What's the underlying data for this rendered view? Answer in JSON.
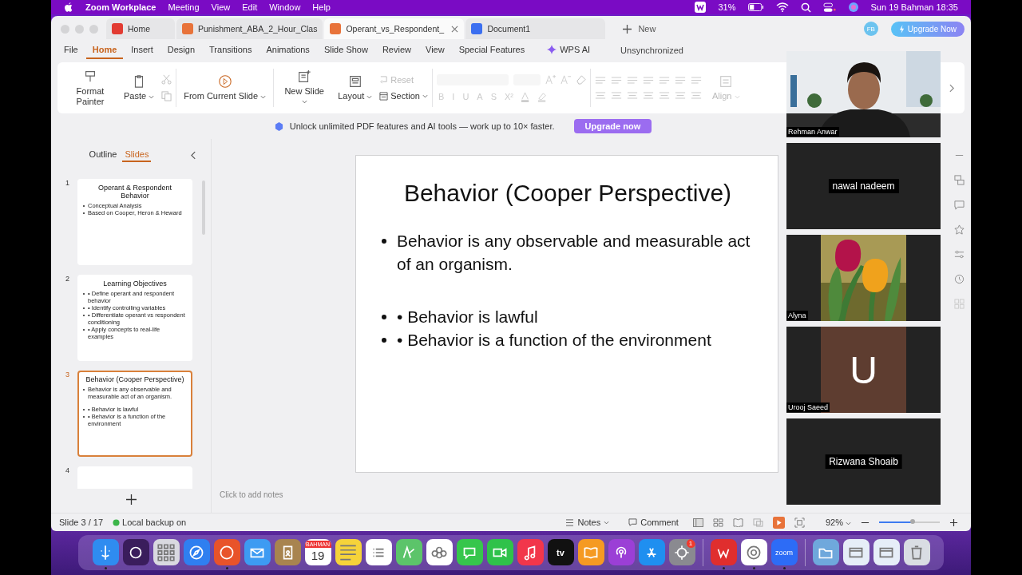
{
  "menubar": {
    "app": "Zoom Workplace",
    "items": [
      "Meeting",
      "View",
      "Edit",
      "Window",
      "Help"
    ],
    "battery": "31%",
    "clock": "Sun 19 Bahman  18:35"
  },
  "tabs": [
    {
      "label": "Home",
      "kind": "wps",
      "selected": false
    },
    {
      "label": "Punishment_ABA_2_Hour_Clas",
      "kind": "slides",
      "selected": false
    },
    {
      "label": "Operant_vs_Respondent_",
      "kind": "slides",
      "selected": true
    },
    {
      "label": "Document1",
      "kind": "doc",
      "selected": false
    }
  ],
  "new_tab": "New",
  "account": "FB",
  "upgrade_button": "Upgrade Now",
  "menu": [
    {
      "label": "File",
      "selected": false
    },
    {
      "label": "Home",
      "selected": true
    },
    {
      "label": "Insert",
      "selected": false
    },
    {
      "label": "Design",
      "selected": false
    },
    {
      "label": "Transitions",
      "selected": false
    },
    {
      "label": "Animations",
      "selected": false
    },
    {
      "label": "Slide Show",
      "selected": false
    },
    {
      "label": "Review",
      "selected": false
    },
    {
      "label": "View",
      "selected": false
    },
    {
      "label": "Special Features",
      "selected": false
    }
  ],
  "wps_ai": "WPS AI",
  "sync_status": "Unsynchronized",
  "ribbon": {
    "format_painter": "Format Painter",
    "paste": "Paste",
    "from_current_slide": "From Current Slide",
    "new_slide": "New Slide",
    "layout": "Layout",
    "reset": "Reset",
    "section": "Section",
    "format_glyphs": [
      "B",
      "I",
      "U",
      "A",
      "S",
      "X²"
    ],
    "align": "Align"
  },
  "banner": {
    "text": "Unlock unlimited PDF features and AI tools — work up to 10× faster.",
    "button": "Upgrade now"
  },
  "sidebar": {
    "tabs": [
      {
        "label": "Outline",
        "selected": false
      },
      {
        "label": "Slides",
        "selected": true
      }
    ],
    "slides": [
      {
        "number": "1",
        "title": "Operant & Respondent Behavior",
        "paragraphs": [
          [
            "Conceptual Analysis",
            "Based on Cooper, Heron & Heward"
          ]
        ],
        "selected": false
      },
      {
        "number": "2",
        "title": "Learning Objectives",
        "paragraphs": [
          [
            "• Define operant and respondent behavior",
            "• Identify controlling variables",
            "• Differentiate operant vs respondent conditioning",
            "• Apply concepts to real-life examples"
          ]
        ],
        "selected": false
      },
      {
        "number": "3",
        "title": "Behavior (Cooper Perspective)",
        "paragraphs": [
          [
            "Behavior is any observable and measurable act of an organism."
          ],
          [
            "• Behavior is lawful",
            "• Behavior is a function of the environment"
          ]
        ],
        "selected": true
      },
      {
        "number": "4",
        "selected": false
      }
    ]
  },
  "slide": {
    "title": "Behavior (Cooper Perspective)",
    "paragraphs": [
      [
        "Behavior is any observable and measurable act of an organism."
      ],
      [
        "• Behavior is lawful",
        "• Behavior is a function of the environment"
      ]
    ]
  },
  "notes_placeholder": "Click to add notes",
  "status": {
    "slide": "Slide 3 / 17",
    "backup": "Local backup on",
    "notes": "Notes",
    "comment": "Comment",
    "zoom": "92%",
    "zoom_slider": {
      "level": 0.55
    }
  },
  "participants": [
    {
      "name": "Rehman Anwar",
      "kind": "video"
    },
    {
      "name": "nawal nadeem",
      "kind": "name"
    },
    {
      "name": "Alyna",
      "kind": "picture"
    },
    {
      "name": "Urooj Saeed",
      "kind": "initial",
      "initial": "U"
    },
    {
      "name": "Rizwana Shoaib",
      "kind": "name"
    }
  ],
  "dock": [
    [
      {
        "kind": "finder",
        "color": "#2f8cf0",
        "running": true
      },
      {
        "kind": "orb",
        "color": "#3a1d5c",
        "running": false
      },
      {
        "kind": "grid",
        "color": "#d9d9e0",
        "running": false
      },
      {
        "kind": "compass",
        "color": "#2f7ff0",
        "running": false
      },
      {
        "kind": "fox",
        "color": "#e8532a",
        "running": true
      },
      {
        "kind": "mail",
        "color": "#3d9bf2",
        "running": false
      },
      {
        "kind": "contacts",
        "color": "#a8844f",
        "running": false
      },
      {
        "kind": "calendar",
        "color": "#ffffff",
        "month": "BAHMAN",
        "day": "19",
        "running": false
      },
      {
        "kind": "notes",
        "color": "#f5d33a",
        "running": false
      },
      {
        "kind": "list",
        "color": "#ffffff",
        "running": false
      },
      {
        "kind": "map",
        "color": "#5cc46a",
        "running": false
      },
      {
        "kind": "flower",
        "color": "#ffffff",
        "running": false
      },
      {
        "kind": "chat",
        "color": "#36c64c",
        "running": false
      },
      {
        "kind": "camera",
        "color": "#2fc24a",
        "running": false
      },
      {
        "kind": "music",
        "color": "#f2364b",
        "running": false
      },
      {
        "kind": "tv",
        "color": "#111111",
        "label": "tv",
        "running": false
      },
      {
        "kind": "book",
        "color": "#f59a22",
        "running": false
      },
      {
        "kind": "podcast",
        "color": "#9b3fd6",
        "running": false
      },
      {
        "kind": "store",
        "color": "#1f8ff0",
        "running": false
      },
      {
        "kind": "gear",
        "color": "#8a8a90",
        "badge": "1",
        "running": false
      }
    ],
    [
      {
        "kind": "wps",
        "color": "#e02e2e",
        "running": true
      },
      {
        "kind": "chrome",
        "color": "#ffffff",
        "running": true
      },
      {
        "kind": "zoom",
        "color": "#2d6cf6",
        "label": "zoom",
        "running": true
      }
    ],
    [
      {
        "kind": "folder",
        "color": "#6fa8dc",
        "running": false
      },
      {
        "kind": "window",
        "color": "#e6eef8",
        "running": false
      },
      {
        "kind": "window",
        "color": "#e6eef8",
        "running": false
      },
      {
        "kind": "trash",
        "color": "#d9dde3",
        "running": false
      }
    ]
  ]
}
